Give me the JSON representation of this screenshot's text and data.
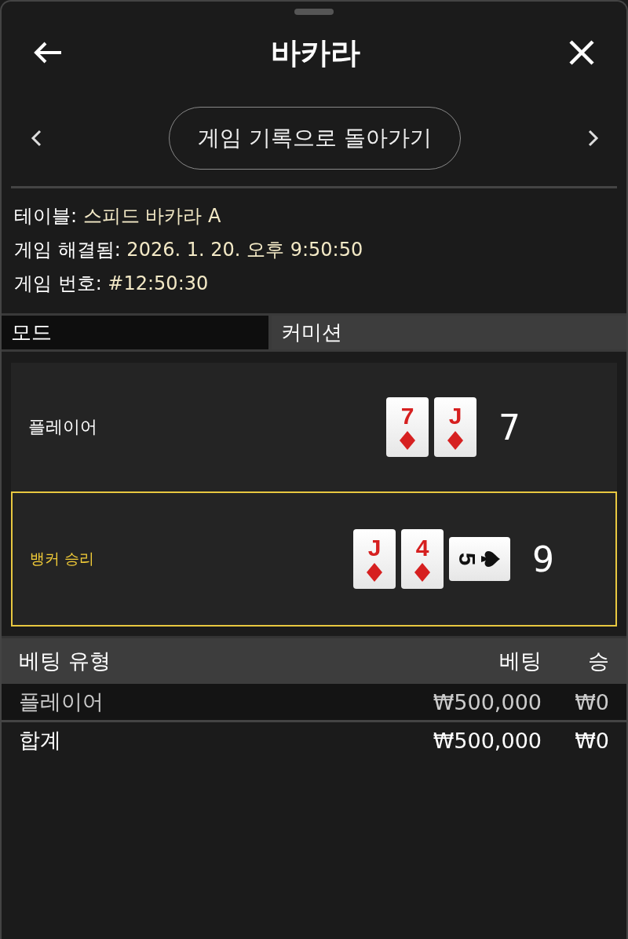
{
  "header": {
    "title": "바카라"
  },
  "nav": {
    "back_label": "게임 기록으로 돌아가기"
  },
  "info": [
    {
      "label": "테이블:",
      "value": "스피드 바카라 A"
    },
    {
      "label": "게임 해결됨:",
      "value": "2026. 1. 20. 오후 9:50:50"
    },
    {
      "label": "게임 번호:",
      "value": "#12:50:30"
    }
  ],
  "mode_row": {
    "label": "모드",
    "value": "커미션"
  },
  "hands": [
    {
      "label": "플레이어",
      "winner": false,
      "score": "7",
      "cards": [
        {
          "rank": "7",
          "kind": "diamond",
          "sideways": false
        },
        {
          "rank": "J",
          "kind": "diamond",
          "sideways": false
        }
      ]
    },
    {
      "label": "뱅커 승리",
      "winner": true,
      "score": "9",
      "cards": [
        {
          "rank": "J",
          "kind": "diamond",
          "sideways": false
        },
        {
          "rank": "4",
          "kind": "diamond",
          "sideways": false
        },
        {
          "rank": "5",
          "kind": "spade",
          "sideways": true
        }
      ]
    }
  ],
  "bets": {
    "columns": [
      "베팅 유형",
      "베팅",
      "승"
    ],
    "rows": [
      {
        "kind": "bet",
        "cells": [
          "플레이어",
          "₩500,000",
          "₩0"
        ]
      },
      {
        "kind": "total",
        "cells": [
          "합계",
          "₩500,000",
          "₩0"
        ]
      }
    ]
  }
}
